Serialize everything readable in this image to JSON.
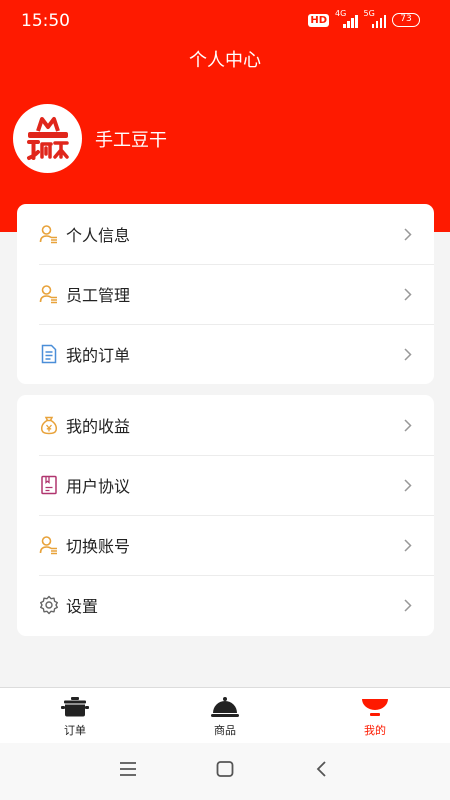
{
  "status": {
    "time": "15:50",
    "hd": "HD",
    "net1": "4G",
    "net2": "5G",
    "battery": "73"
  },
  "header": {
    "title": "个人中心"
  },
  "profile": {
    "name": "手工豆干",
    "avatar_icon": "shop-logo-icon"
  },
  "menu_group_1": [
    {
      "label": "个人信息",
      "icon": "person-list-icon"
    },
    {
      "label": "员工管理",
      "icon": "person-list-icon"
    },
    {
      "label": "我的订单",
      "icon": "document-icon"
    }
  ],
  "menu_group_2": [
    {
      "label": "我的收益",
      "icon": "money-bag-icon"
    },
    {
      "label": "用户协议",
      "icon": "agreement-icon"
    },
    {
      "label": "切换账号",
      "icon": "person-list-icon"
    },
    {
      "label": "设置",
      "icon": "gear-icon"
    }
  ],
  "tabs": [
    {
      "label": "订单",
      "icon": "pot-icon",
      "active": false
    },
    {
      "label": "商品",
      "icon": "cloche-icon",
      "active": false
    },
    {
      "label": "我的",
      "icon": "bowl-icon",
      "active": true
    }
  ],
  "colors": {
    "brand": "#fe1a00",
    "icon_orange": "#e8a23a",
    "icon_blue": "#4a8ed8",
    "icon_magenta": "#b0356f"
  }
}
